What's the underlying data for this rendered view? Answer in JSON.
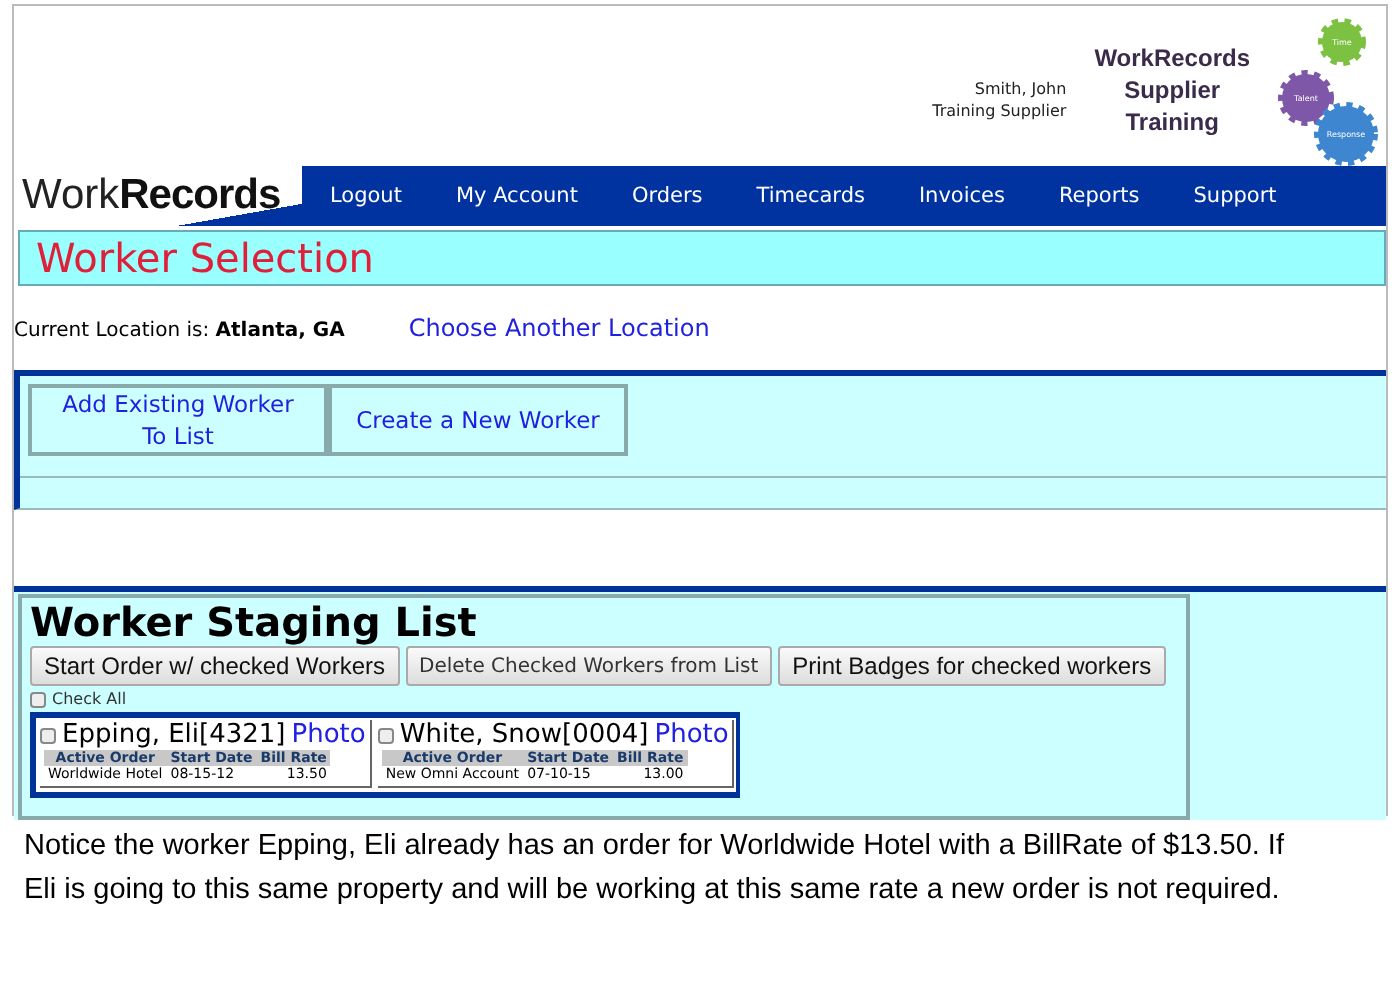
{
  "header": {
    "user_name": "Smith, John",
    "user_role": "Training Supplier",
    "badge_lines": [
      "WorkRecords",
      "Supplier",
      "Training"
    ],
    "gears": [
      {
        "label": "Time",
        "color": "#7cc142"
      },
      {
        "label": "Talent",
        "color": "#7e57a8"
      },
      {
        "label": "Response",
        "color": "#3f86d0"
      }
    ]
  },
  "logo": {
    "part_1": "Work",
    "part_2": "Records"
  },
  "nav": [
    "Logout",
    "My Account",
    "Orders",
    "Timecards",
    "Invoices",
    "Reports",
    "Support"
  ],
  "page_title": "Worker Selection",
  "location": {
    "label": "Current Location is:",
    "value": "Atlanta, GA",
    "link": "Choose Another Location"
  },
  "actions": [
    "Add Existing Worker To List",
    "Create a New Worker"
  ],
  "staging": {
    "title": "Worker Staging List",
    "buttons": [
      {
        "label": "Start Order w/ checked Workers",
        "kind": "large"
      },
      {
        "label": "Delete Checked Workers from List",
        "kind": "small"
      },
      {
        "label": "Print Badges for checked workers",
        "kind": "large"
      }
    ],
    "check_all": {
      "label": "Check All",
      "checked": false
    },
    "workers": [
      {
        "name": "Epping, Eli[4321]",
        "photo_link": "Photo",
        "checked": false,
        "columns": [
          "Active Order",
          "Start Date",
          "Bill Rate"
        ],
        "order": "Worldwide Hotel",
        "start": "08-15-12",
        "rate": "13.50"
      },
      {
        "name": "White, Snow[0004]",
        "photo_link": "Photo",
        "checked": false,
        "columns": [
          "Active Order",
          "Start Date",
          "Bill Rate"
        ],
        "order": "New Omni Account",
        "start": "07-10-15",
        "rate": "13.00"
      }
    ]
  },
  "caption": "Notice the worker Epping, Eli already has an order for Worldwide Hotel with a BillRate of $13.50.  If Eli is going to this same property and will be working at this same rate a new order is not required."
}
